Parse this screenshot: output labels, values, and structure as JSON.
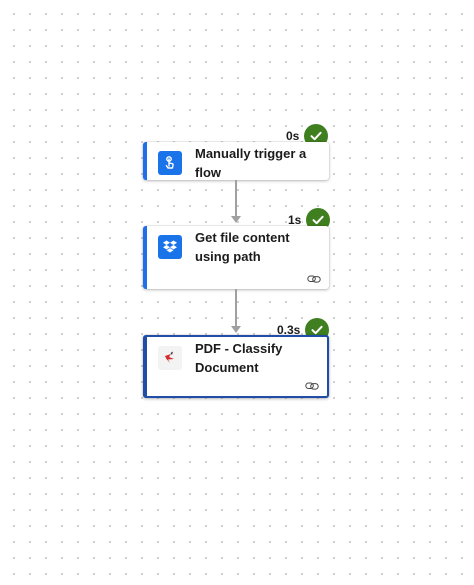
{
  "flow": {
    "steps": [
      {
        "title": "Manually trigger a flow",
        "duration": "0s",
        "status": "succeeded",
        "icon": "manual-trigger-icon",
        "icon_bg": "#1a73e8",
        "has_link": false
      },
      {
        "title": "Get file content using path",
        "duration": "1s",
        "status": "succeeded",
        "icon": "dropbox-icon",
        "icon_bg": "#1a73e8",
        "has_link": true
      },
      {
        "title": "PDF - Classify Document",
        "duration": "0.3s",
        "status": "succeeded",
        "icon": "pdf-classify-icon",
        "icon_bg": "#f3f3f3",
        "has_link": true,
        "selected": true
      }
    ]
  },
  "colors": {
    "accent": "#1f6feb",
    "selected_border": "#1e4ea8",
    "success": "#3f7f1f",
    "connector": "#a0a0a0"
  }
}
